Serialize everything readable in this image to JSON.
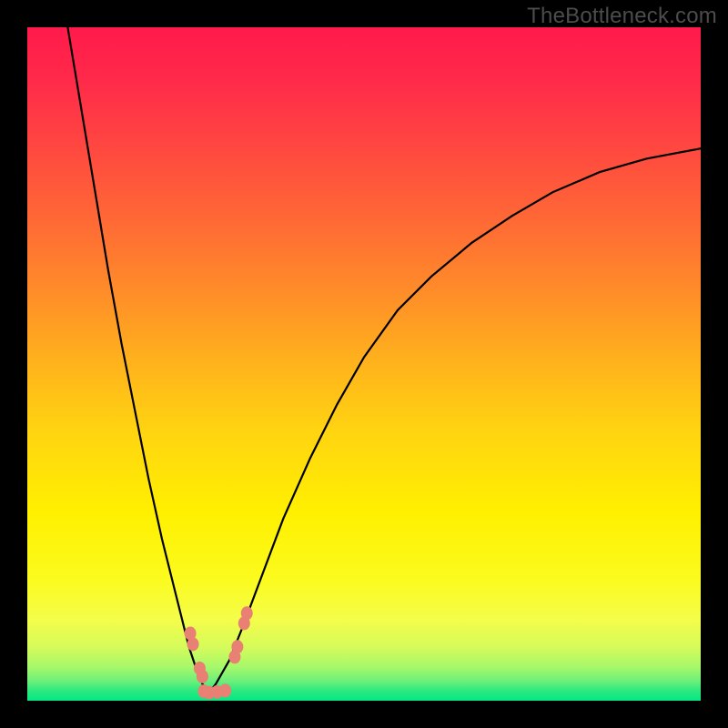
{
  "watermark": "TheBottleneck.com",
  "colors": {
    "background": "#000000",
    "gradient_top": "#ff1a4b",
    "gradient_mid": "#fff000",
    "gradient_bottom": "#05e884",
    "curve": "#000000",
    "bead": "#e88074"
  },
  "chart_data": {
    "type": "line",
    "title": "",
    "xlabel": "",
    "ylabel": "",
    "xlim": [
      0,
      100
    ],
    "ylim": [
      0,
      100
    ],
    "note": "Axes are unlabeled in source image; x and y expressed as 0–100 percent of plot area. y=0 is bottom (green), y=100 is top (red). Curve resembles an absolute-deviation / bottleneck profile with its minimum near x≈27.",
    "series": [
      {
        "name": "left-branch",
        "x": [
          6,
          8,
          10,
          12,
          14,
          16,
          18,
          20,
          22,
          23,
          24,
          25,
          26,
          27
        ],
        "y": [
          100,
          88,
          76,
          64,
          53,
          43,
          33,
          24,
          16,
          12,
          8,
          5,
          2.5,
          1.2
        ]
      },
      {
        "name": "right-branch",
        "x": [
          27,
          28,
          30,
          32,
          35,
          38,
          42,
          46,
          50,
          55,
          60,
          66,
          72,
          78,
          85,
          92,
          100
        ],
        "y": [
          1.2,
          2.5,
          6,
          11,
          19,
          27,
          36,
          44,
          51,
          58,
          63,
          68,
          72,
          75.5,
          78.5,
          80.5,
          82
        ]
      }
    ],
    "markers": [
      {
        "name": "bead-left-upper",
        "x": 24.2,
        "y": 10.0
      },
      {
        "name": "bead-left-upper2",
        "x": 24.6,
        "y": 8.4
      },
      {
        "name": "bead-left-lower",
        "x": 25.6,
        "y": 4.8
      },
      {
        "name": "bead-left-lower2",
        "x": 26.0,
        "y": 3.6
      },
      {
        "name": "bead-bottom-1",
        "x": 26.2,
        "y": 1.4
      },
      {
        "name": "bead-bottom-2",
        "x": 27.0,
        "y": 1.2
      },
      {
        "name": "bead-bottom-3",
        "x": 28.2,
        "y": 1.3
      },
      {
        "name": "bead-bottom-4",
        "x": 29.4,
        "y": 1.5
      },
      {
        "name": "bead-right-lower",
        "x": 30.8,
        "y": 6.5
      },
      {
        "name": "bead-right-lower2",
        "x": 31.2,
        "y": 8.0
      },
      {
        "name": "bead-right-upper",
        "x": 32.2,
        "y": 11.5
      },
      {
        "name": "bead-right-upper2",
        "x": 32.6,
        "y": 13.0
      }
    ]
  }
}
